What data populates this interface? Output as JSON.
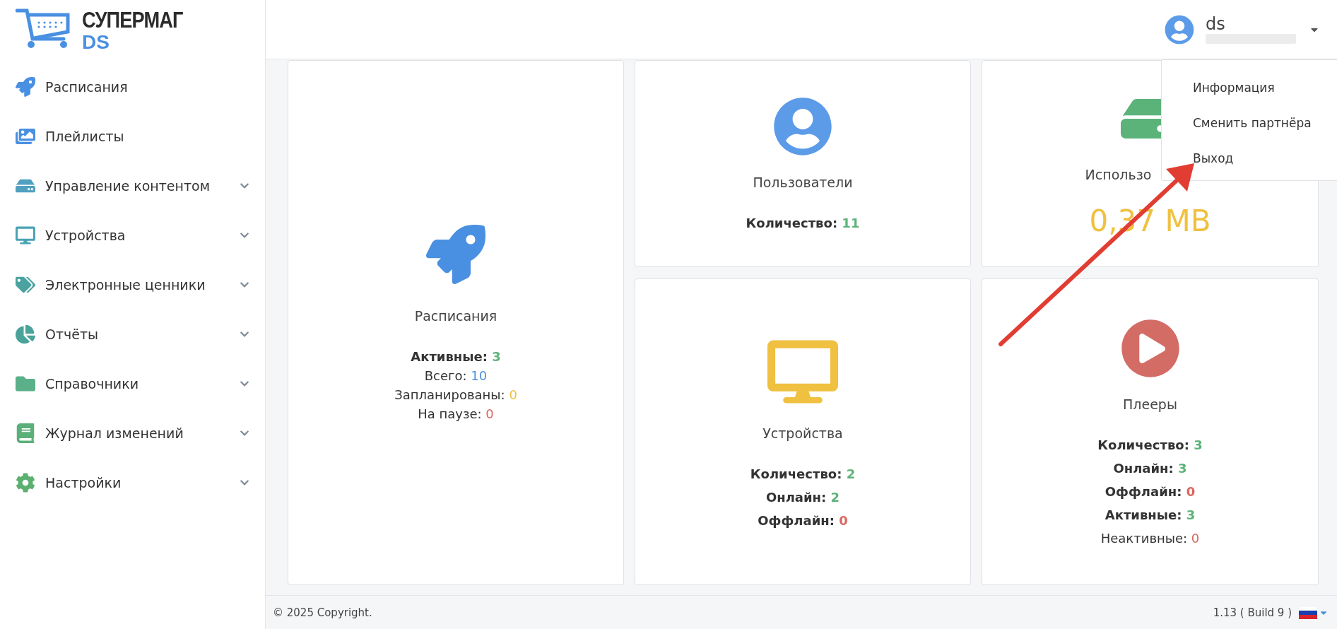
{
  "logo": {
    "name": "СУПЕРМАГ",
    "suffix": "DS"
  },
  "sidebar": {
    "items": [
      {
        "kind": "rocket",
        "label": "Расписания",
        "expandable": false
      },
      {
        "kind": "images",
        "label": "Плейлисты",
        "expandable": false
      },
      {
        "kind": "drive",
        "label": "Управление контентом",
        "expandable": true
      },
      {
        "kind": "monitor",
        "label": "Устройства",
        "expandable": true
      },
      {
        "kind": "tags",
        "label": "Электронные ценники",
        "expandable": true
      },
      {
        "kind": "pie",
        "label": "Отчёты",
        "expandable": true
      },
      {
        "kind": "folder",
        "label": "Справочники",
        "expandable": true
      },
      {
        "kind": "book",
        "label": "Журнал изменений",
        "expandable": true
      },
      {
        "kind": "gear",
        "label": "Настройки",
        "expandable": true
      }
    ]
  },
  "user": {
    "name": "ds"
  },
  "user_menu": {
    "items": [
      "Информация",
      "Сменить партнёра",
      "Выход"
    ]
  },
  "cards": [
    {
      "kind": "rocket",
      "title": "Расписания",
      "stats": [
        {
          "label": "Активные:",
          "value": "3",
          "bold": true,
          "color": "#5cb37a"
        },
        {
          "label": "Всего:",
          "value": "10",
          "bold": false,
          "color": "#4a90e2"
        },
        {
          "label": "Запланированы:",
          "value": "0",
          "bold": false,
          "color": "#f0c040"
        },
        {
          "label": "На паузе:",
          "value": "0",
          "bold": false,
          "color": "#d9675f"
        }
      ]
    },
    {
      "kind": "user",
      "title": "Пользователи",
      "stats": [
        {
          "label": "Количество:",
          "value": "11",
          "bold": true,
          "color": "#5cb37a"
        }
      ]
    },
    {
      "kind": "drive",
      "title": "Использо",
      "big_value": "0,37 MB"
    },
    {
      "kind": "monitor",
      "title": "Устройства",
      "stats": [
        {
          "label": "Количество:",
          "value": "2",
          "bold": true,
          "color": "#5cb37a"
        },
        {
          "label": "Онлайн:",
          "value": "2",
          "bold": true,
          "color": "#5cb37a"
        },
        {
          "label": "Оффлайн:",
          "value": "0",
          "bold": true,
          "color": "#d9675f"
        }
      ]
    },
    {
      "kind": "play",
      "title": "Плееры",
      "stats": [
        {
          "label": "Количество:",
          "value": "3",
          "bold": true,
          "color": "#5cb37a"
        },
        {
          "label": "Онлайн:",
          "value": "3",
          "bold": true,
          "color": "#5cb37a"
        },
        {
          "label": "Оффлайн:",
          "value": "0",
          "bold": true,
          "color": "#d9675f"
        },
        {
          "label": "Активные:",
          "value": "3",
          "bold": true,
          "color": "#5cb37a"
        },
        {
          "label": "Неактивные:",
          "value": "0",
          "bold": false,
          "color": "#d9675f"
        }
      ]
    }
  ],
  "footer": {
    "copyright": "© 2025 Copyright.",
    "version": "1.13 ( Build 9 )"
  }
}
